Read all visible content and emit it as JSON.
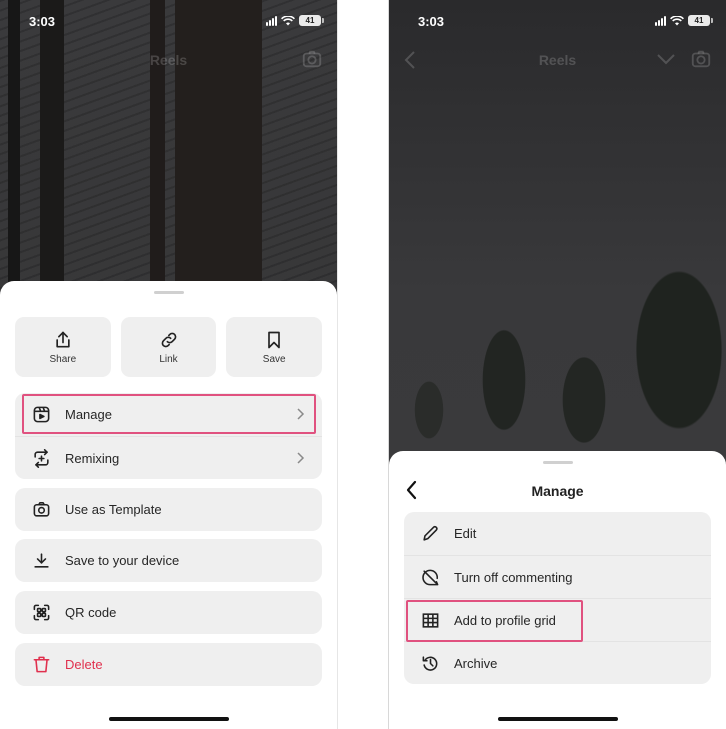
{
  "status_bar": {
    "time": "3:03",
    "battery": "41"
  },
  "left_phone": {
    "topbar": {
      "title": "Reels"
    },
    "quick_actions": [
      {
        "label": "Share",
        "icon": "share-icon"
      },
      {
        "label": "Link",
        "icon": "link-icon"
      },
      {
        "label": "Save",
        "icon": "bookmark-icon"
      }
    ],
    "menu_groups": [
      [
        {
          "label": "Manage",
          "icon": "reels-icon",
          "chevron": true,
          "highlighted": true
        },
        {
          "label": "Remixing",
          "icon": "remix-icon",
          "chevron": true
        }
      ],
      [
        {
          "label": "Use as Template",
          "icon": "camera-icon"
        }
      ],
      [
        {
          "label": "Save to your device",
          "icon": "download-icon"
        }
      ],
      [
        {
          "label": "QR code",
          "icon": "qr-code-icon"
        }
      ],
      [
        {
          "label": "Delete",
          "icon": "trash-icon",
          "danger": true
        }
      ]
    ]
  },
  "right_phone": {
    "topbar": {
      "title": "Reels"
    },
    "sheet_title": "Manage",
    "menu": [
      {
        "label": "Edit",
        "icon": "pencil-icon"
      },
      {
        "label": "Turn off commenting",
        "icon": "comment-off-icon"
      },
      {
        "label": "Add to profile grid",
        "icon": "grid-icon",
        "highlighted": true
      },
      {
        "label": "Archive",
        "icon": "archive-icon"
      }
    ]
  },
  "colors": {
    "highlight": "#e0517f",
    "danger": "#e0304e",
    "row_background": "#efefef"
  }
}
